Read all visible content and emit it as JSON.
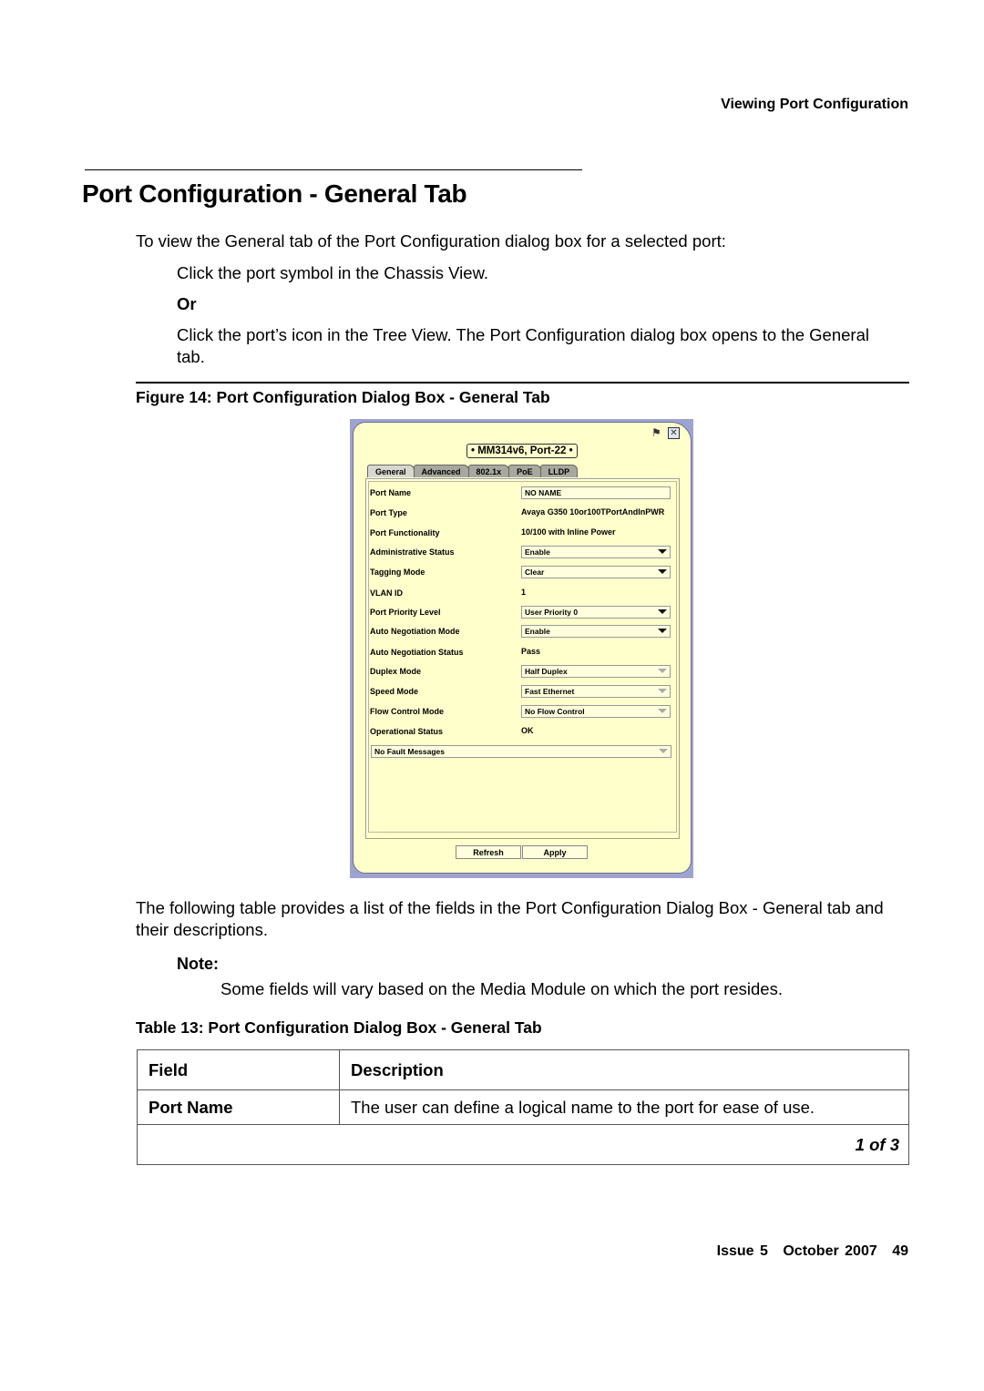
{
  "header": {
    "running_title": "Viewing Port Configuration"
  },
  "section": {
    "title": "Port Configuration - General Tab",
    "intro": "To view the General tab of the Port Configuration dialog box for a selected port:",
    "step1": "Click the port symbol in the Chassis View.",
    "or": "Or",
    "step2": "Click the port’s icon in the Tree View. The Port Configuration dialog box opens to the General tab."
  },
  "figure": {
    "caption": "Figure 14: Port Configuration Dialog Box - General Tab",
    "dialog": {
      "device_title": "• MM314v6, Port-22 •",
      "icons": {
        "help": "help-icon",
        "close": "close-icon"
      },
      "tabs": [
        {
          "label": "General",
          "active": true
        },
        {
          "label": "Advanced",
          "active": false
        },
        {
          "label": "802.1x",
          "active": false
        },
        {
          "label": "PoE",
          "active": false
        },
        {
          "label": "LLDP",
          "active": false
        }
      ],
      "fields": [
        {
          "label": "Port Name",
          "value": "NO NAME",
          "kind": "text"
        },
        {
          "label": "Port Type",
          "value": "Avaya G350 10or100TPortAndInPWR",
          "kind": "static"
        },
        {
          "label": "Port Functionality",
          "value": "10/100 with Inline Power",
          "kind": "static"
        },
        {
          "label": "Administrative Status",
          "value": "Enable",
          "kind": "select"
        },
        {
          "label": "Tagging Mode",
          "value": "Clear",
          "kind": "select"
        },
        {
          "label": "VLAN ID",
          "value": "1",
          "kind": "static"
        },
        {
          "label": "Port Priority Level",
          "value": "User Priority 0",
          "kind": "select"
        },
        {
          "label": "Auto Negotiation Mode",
          "value": "Enable",
          "kind": "select"
        },
        {
          "label": "Auto Negotiation Status",
          "value": "Pass",
          "kind": "static"
        },
        {
          "label": "Duplex Mode",
          "value": "Half Duplex",
          "kind": "select-disabled"
        },
        {
          "label": "Speed Mode",
          "value": "Fast Ethernet",
          "kind": "select-disabled"
        },
        {
          "label": "Flow Control Mode",
          "value": "No Flow Control",
          "kind": "select-disabled"
        },
        {
          "label": "Operational Status",
          "value": "OK",
          "kind": "static"
        }
      ],
      "fault_messages": "No Fault Messages",
      "buttons": {
        "refresh": "Refresh",
        "apply": "Apply"
      }
    }
  },
  "after_figure": {
    "text": "The following table provides a list of the fields in the Port Configuration Dialog Box - General tab and their descriptions.",
    "note_label": "Note:",
    "note_text": "Some fields will vary based on the Media Module on which the port resides."
  },
  "table": {
    "caption": "Table 13: Port Configuration Dialog Box - General Tab",
    "headers": [
      "Field",
      "Description"
    ],
    "rows": [
      {
        "field": "Port Name",
        "description": "The user can define a logical name to the port for ease of use."
      }
    ],
    "pager": "1 of 3"
  },
  "footer": {
    "issue": "Issue 5",
    "date": "October 2007",
    "page": "49"
  }
}
